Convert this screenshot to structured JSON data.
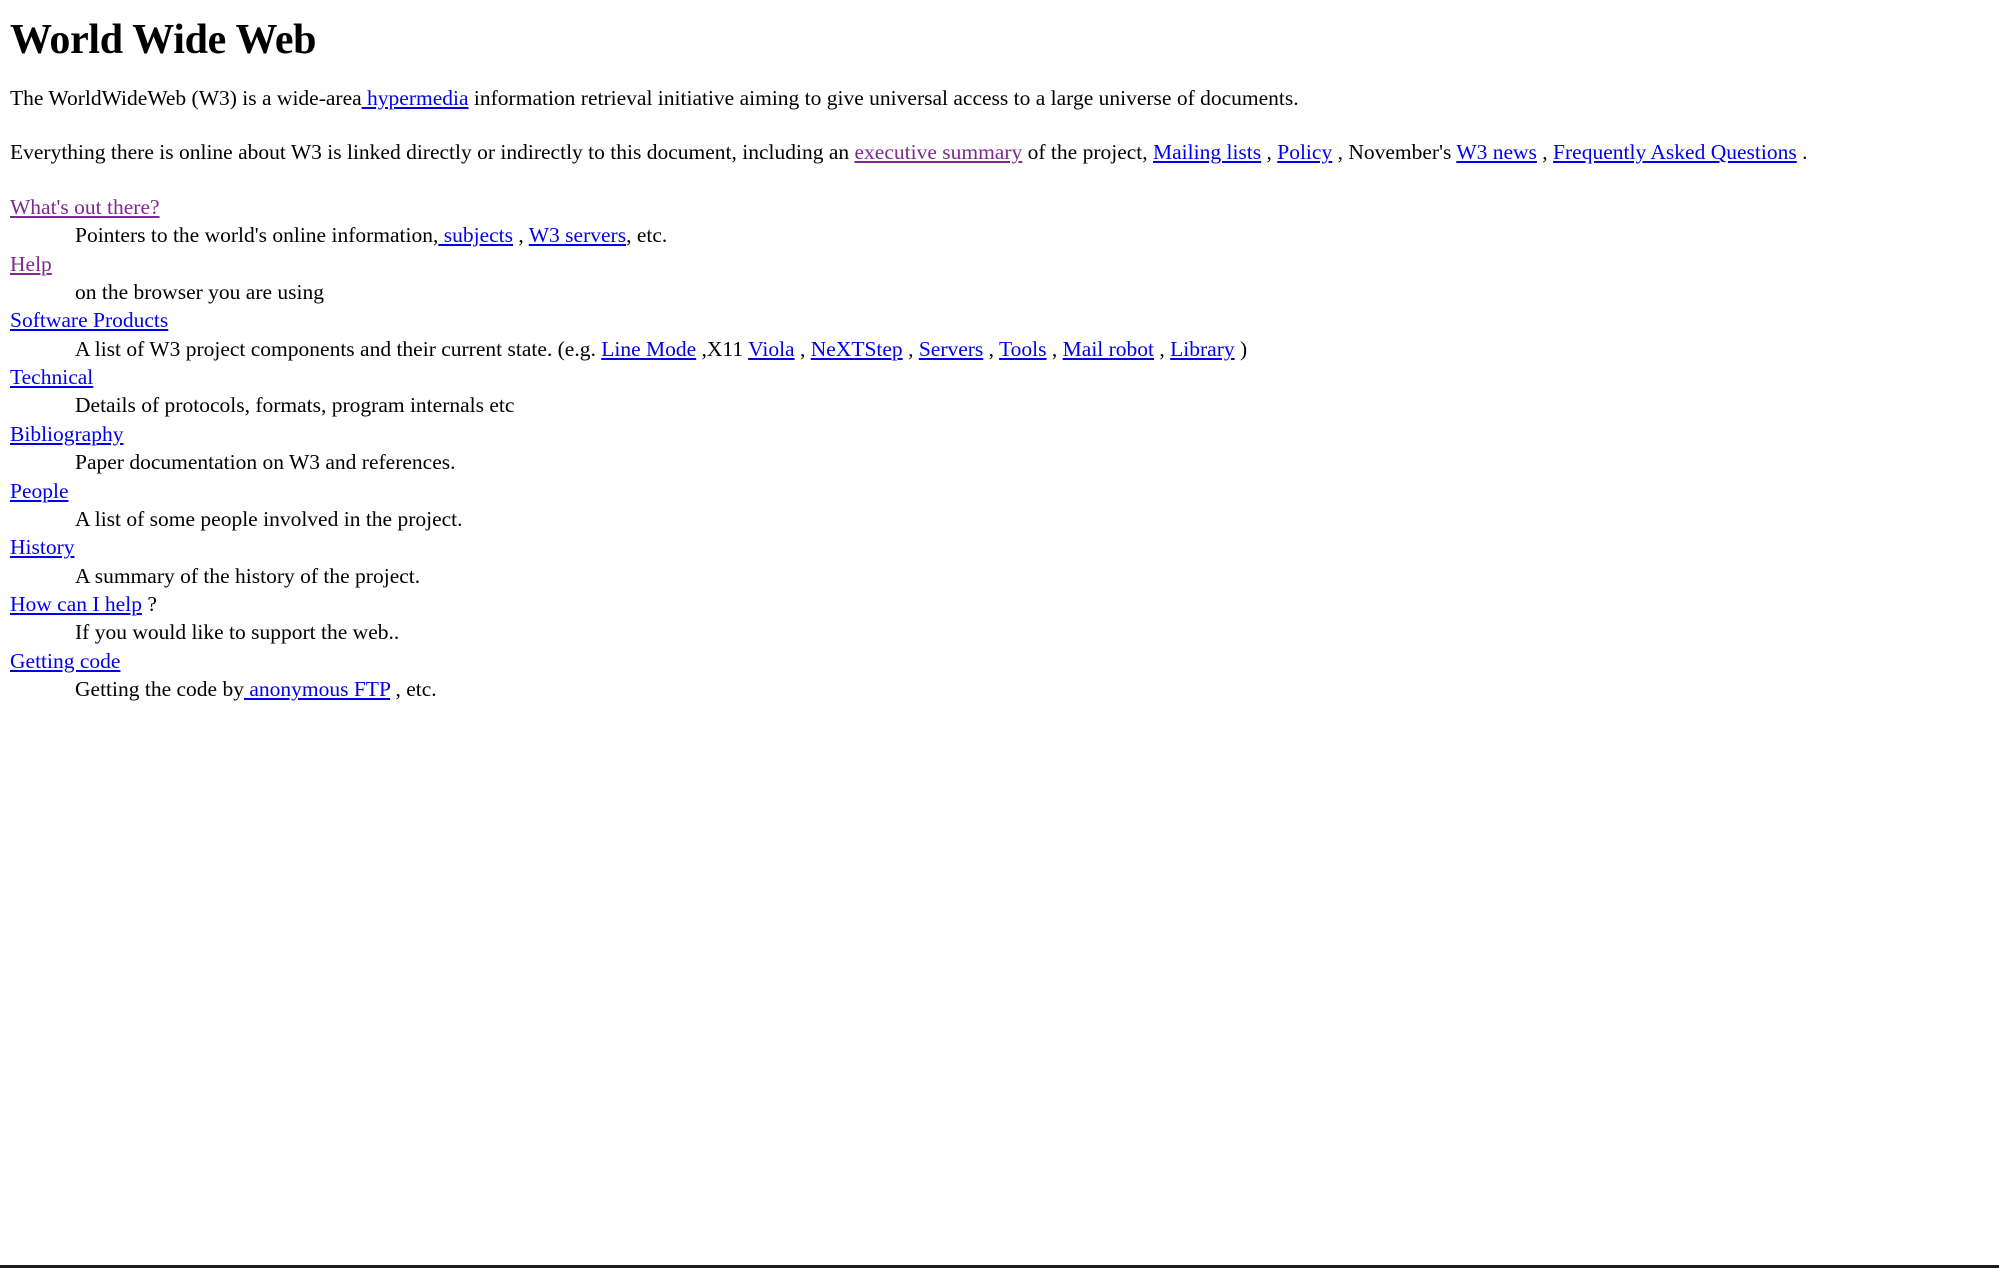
{
  "document": {
    "title": "World Wide Web",
    "colors": {
      "background": "#ffffff",
      "text": "#000000",
      "link": "#0000ee",
      "visited_link": "#7d2a8e"
    }
  },
  "intro": {
    "p1_before": "The WorldWideWeb (W3) is a wide-area",
    "p1_link_hypermedia": " hypermedia",
    "p1_after": " information retrieval initiative aiming to give universal access to a large universe of documents.",
    "p2_before": "Everything there is online about W3 is linked directly or indirectly to this document, including an ",
    "p2_link_executive_summary": "executive summary",
    "p2_mid1": " of the project, ",
    "p2_link_mailing_lists": "Mailing lists",
    "p2_mid2": " , ",
    "p2_link_policy": "Policy",
    "p2_mid3": " , November's ",
    "p2_link_w3_news": "W3 news",
    "p2_mid4": " , ",
    "p2_link_faq": "Frequently Asked Questions",
    "p2_after": " ."
  },
  "entries": [
    {
      "term_text": "What's out there?",
      "term_style": "visited",
      "term_suffix": "",
      "desc_parts": [
        {
          "type": "text",
          "text": "Pointers to the world's online information,"
        },
        {
          "type": "link",
          "text": " subjects",
          "style": "link"
        },
        {
          "type": "text",
          "text": " , "
        },
        {
          "type": "link",
          "text": "W3 servers",
          "style": "link"
        },
        {
          "type": "text",
          "text": ", etc."
        }
      ]
    },
    {
      "term_text": "Help",
      "term_style": "visited",
      "term_suffix": "",
      "desc_parts": [
        {
          "type": "text",
          "text": "on the browser you are using"
        }
      ]
    },
    {
      "term_text": "Software Products",
      "term_style": "link",
      "term_suffix": "",
      "desc_parts": [
        {
          "type": "text",
          "text": "A list of W3 project components and their current state. (e.g. "
        },
        {
          "type": "link",
          "text": "Line Mode",
          "style": "link"
        },
        {
          "type": "text",
          "text": " ,X11 "
        },
        {
          "type": "link",
          "text": "Viola",
          "style": "link"
        },
        {
          "type": "text",
          "text": " , "
        },
        {
          "type": "link",
          "text": "NeXTStep",
          "style": "link"
        },
        {
          "type": "text",
          "text": " , "
        },
        {
          "type": "link",
          "text": "Servers",
          "style": "link"
        },
        {
          "type": "text",
          "text": " , "
        },
        {
          "type": "link",
          "text": "Tools",
          "style": "link"
        },
        {
          "type": "text",
          "text": " , "
        },
        {
          "type": "link",
          "text": " Mail robot",
          "style": "link"
        },
        {
          "type": "text",
          "text": " , "
        },
        {
          "type": "link",
          "text": " Library",
          "style": "link"
        },
        {
          "type": "text",
          "text": " )"
        }
      ]
    },
    {
      "term_text": "Technical",
      "term_style": "link",
      "term_suffix": "",
      "desc_parts": [
        {
          "type": "text",
          "text": "Details of protocols, formats, program internals etc"
        }
      ]
    },
    {
      "term_text": "Bibliography",
      "term_style": "link",
      "term_suffix": "",
      "desc_parts": [
        {
          "type": "text",
          "text": "Paper documentation on W3 and references."
        }
      ]
    },
    {
      "term_text": "People",
      "term_style": "link",
      "term_suffix": "",
      "desc_parts": [
        {
          "type": "text",
          "text": "A list of some people involved in the project."
        }
      ]
    },
    {
      "term_text": "History",
      "term_style": "link",
      "term_suffix": "",
      "desc_parts": [
        {
          "type": "text",
          "text": "A summary of the history of the project."
        }
      ]
    },
    {
      "term_text": "How can I help",
      "term_style": "link",
      "term_suffix": " ?",
      "desc_parts": [
        {
          "type": "text",
          "text": "If you would like to support the web.."
        }
      ]
    },
    {
      "term_text": "Getting code",
      "term_style": "link",
      "term_suffix": "",
      "desc_parts": [
        {
          "type": "text",
          "text": "Getting the code by"
        },
        {
          "type": "link",
          "text": " anonymous FTP",
          "style": "link"
        },
        {
          "type": "text",
          "text": " , etc."
        }
      ]
    }
  ]
}
